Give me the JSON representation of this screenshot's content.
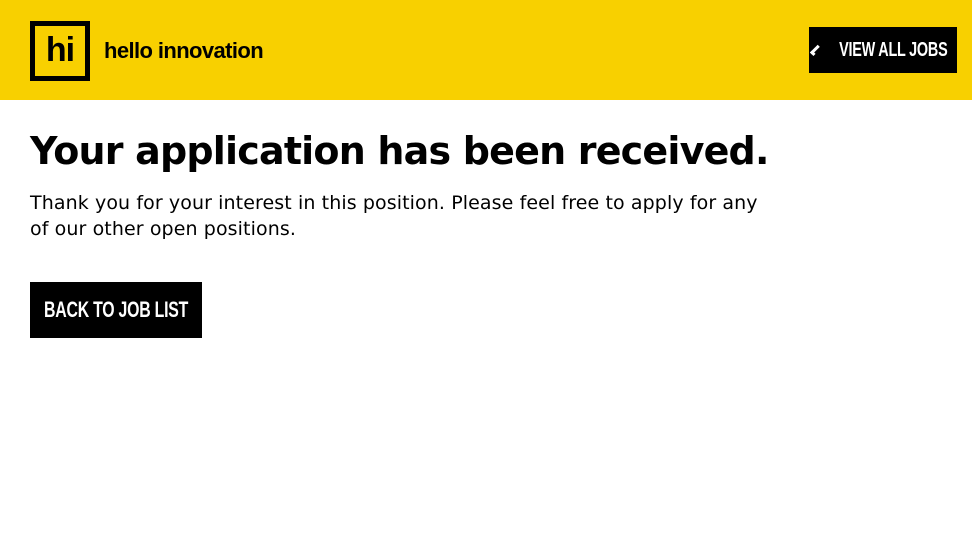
{
  "header": {
    "logo_mark": "hi",
    "logo_text": "hello innovation",
    "view_all_label": "VIEW ALL JOBS",
    "background_color": "#f8d000"
  },
  "main": {
    "title": "Your application has been received.",
    "message": "Thank you for your interest in this position. Please feel free to apply for any of our other open positions.",
    "back_button_label": "BACK TO JOB LIST"
  },
  "icons": {
    "view_all_icon": "chevron-left-icon"
  }
}
